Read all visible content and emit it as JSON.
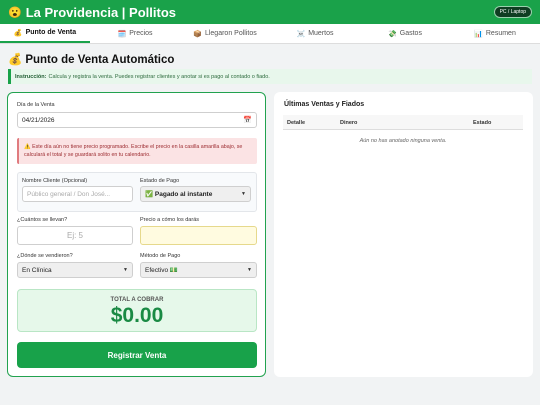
{
  "header": {
    "logo_icon": "😮",
    "title": "La Providencia | Pollitos",
    "device_badge": "PC / Laptop"
  },
  "tabs": [
    {
      "icon": "💰",
      "label": "Punto de Venta",
      "active": true
    },
    {
      "icon": "🗓️",
      "label": "Precios"
    },
    {
      "icon": "📦",
      "label": "Llegaron Pollitos"
    },
    {
      "icon": "☠️",
      "label": "Muertos"
    },
    {
      "icon": "💸",
      "label": "Gastos"
    },
    {
      "icon": "📊",
      "label": "Resumen"
    }
  ],
  "page": {
    "title_icon": "💰",
    "title": "Punto de Venta Automático",
    "instruction_label": "Instrucción:",
    "instruction_text": "Calcula y registra la venta. Puedes registrar clientes y anotar si es pago al contado o fiado."
  },
  "form": {
    "date_label": "Día de la Venta",
    "date_value": "04/21/2026",
    "calendar_icon": "📅",
    "alert_icon": "⚠️",
    "alert_text": "Este día aún no tiene precio programado. Escribe el precio en la casilla amarilla abajo, se calculará el total y se guardará solito en tu calendario.",
    "client_label": "Nombre Cliente (Opcional)",
    "client_placeholder": "Público general / Don José...",
    "payment_status_label": "Estado de Pago",
    "payment_status_value": "✅ Pagado al instante",
    "qty_label": "¿Cuántos se llevan?",
    "qty_placeholder": "Ej: 5",
    "price_label": "Precio a cómo los darás",
    "price_value": "",
    "place_label": "¿Dónde se vendieron?",
    "place_value": "En Clínica",
    "method_label": "Método de Pago",
    "method_value": "Efectivo 💵",
    "total_label": "TOTAL A COBRAR",
    "total_value": "$0.00",
    "submit_label": "Registrar Venta"
  },
  "recent": {
    "title": "Últimas Ventas y Fiados",
    "columns": [
      "Detalle",
      "Dinero",
      "Estado"
    ],
    "empty_text": "Aún no has anotado ninguna venta."
  },
  "colors": {
    "brand": "#1aa24a",
    "alert": "#9c2b30",
    "total": "#1a8a44"
  }
}
